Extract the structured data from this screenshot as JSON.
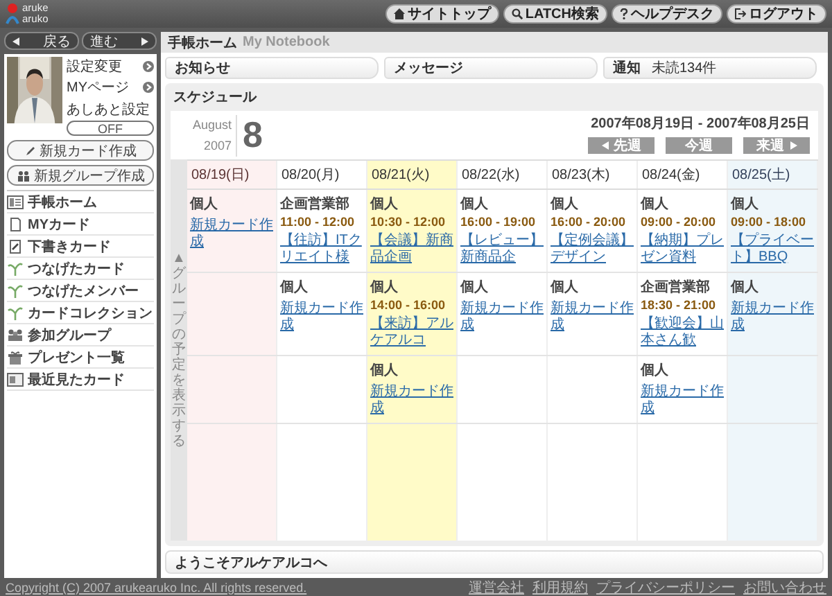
{
  "logo": {
    "line1": "aruke",
    "line2": "aruko"
  },
  "top_links": [
    {
      "kind": "home",
      "label": "サイトトップ"
    },
    {
      "kind": "search",
      "label": "LATCH検索"
    },
    {
      "kind": "help",
      "label": "ヘルプデスク"
    },
    {
      "kind": "logout",
      "label": "ログアウト"
    }
  ],
  "nav": {
    "back": "戻る",
    "forward": "進む"
  },
  "profile": {
    "links": [
      "設定変更",
      "MYページ"
    ],
    "footprint_label": "あしあと設定",
    "footprint_toggle": "OFF"
  },
  "actions": [
    {
      "kind": "pen",
      "label": "新規カード作成"
    },
    {
      "kind": "group",
      "label": "新規グループ作成"
    }
  ],
  "menu": [
    {
      "kind": "home",
      "label": "手帳ホーム"
    },
    {
      "kind": "card",
      "label": "MYカード"
    },
    {
      "kind": "draft",
      "label": "下書きカード"
    },
    {
      "kind": "link",
      "label": "つなげたカード"
    },
    {
      "kind": "link",
      "label": "つなげたメンバー"
    },
    {
      "kind": "link",
      "label": "カードコレクション"
    },
    {
      "kind": "group",
      "label": "参加グループ"
    },
    {
      "kind": "gift",
      "label": "プレゼント一覧"
    },
    {
      "kind": "recent",
      "label": "最近見たカード"
    }
  ],
  "page": {
    "title": "手帳ホーム",
    "subtitle": "My Notebook"
  },
  "tabs": [
    {
      "label": "お知らせ"
    },
    {
      "label": "メッセージ"
    },
    {
      "label": "通知",
      "count": "未読134件"
    }
  ],
  "schedule": {
    "title": "スケジュール",
    "month": "August",
    "year": "2007",
    "day": "8",
    "range": "2007年08月19日 - 2007年08月25日",
    "buttons": [
      {
        "kind": "prev",
        "label": "先週"
      },
      {
        "kind": "current",
        "label": "今週"
      },
      {
        "kind": "next",
        "label": "来週"
      }
    ],
    "side_toggle": "▲グループの予定を表示する",
    "days": [
      {
        "label": "08/19(日)",
        "kind": "sunday",
        "today": false,
        "entries": [
          {
            "group": "個人",
            "link": "新規カード作成"
          }
        ]
      },
      {
        "label": "08/20(月)",
        "kind": "weekday",
        "today": false,
        "entries": [
          {
            "group": "企画営業部",
            "time": "11:00 - 12:00",
            "link": "【往訪】ITクリエイト様"
          },
          {
            "group": "個人",
            "link": "新規カード作成"
          }
        ]
      },
      {
        "label": "08/21(火)",
        "kind": "weekday",
        "today": true,
        "entries": [
          {
            "group": "個人",
            "time": "10:30 - 12:00",
            "link": "【会議】新商品企画"
          },
          {
            "group": "個人",
            "time": "14:00 - 16:00",
            "link": "【来訪】アルケアルコ"
          },
          {
            "group": "個人",
            "link": "新規カード作成"
          }
        ]
      },
      {
        "label": "08/22(水)",
        "kind": "weekday",
        "today": false,
        "entries": [
          {
            "group": "個人",
            "time": "16:00 - 19:00",
            "link": "【レビュー】新商品企"
          },
          {
            "group": "個人",
            "link": "新規カード作成"
          }
        ]
      },
      {
        "label": "08/23(木)",
        "kind": "weekday",
        "today": false,
        "entries": [
          {
            "group": "個人",
            "time": "16:00 - 20:00",
            "link": "【定例会議】デザイン"
          },
          {
            "group": "個人",
            "link": "新規カード作成"
          }
        ]
      },
      {
        "label": "08/24(金)",
        "kind": "weekday",
        "today": false,
        "entries": [
          {
            "group": "個人",
            "time": "09:00 - 20:00",
            "link": "【納期】プレゼン資料"
          },
          {
            "group": "企画営業部",
            "time": "18:30 - 21:00",
            "link": "【歓迎会】山本さん歓"
          },
          {
            "group": "個人",
            "link": "新規カード作成"
          }
        ]
      },
      {
        "label": "08/25(土)",
        "kind": "saturday",
        "today": false,
        "entries": [
          {
            "group": "個人",
            "time": "09:00 - 18:00",
            "link": "【プライベート】BBQ"
          },
          {
            "group": "個人",
            "link": "新規カード作成"
          }
        ]
      }
    ]
  },
  "welcome": "ようこそアルケアルコへ",
  "footer": {
    "copyright": "Copyright (C) 2007 arukearuko Inc. All rights reserved.",
    "links": [
      "運営会社",
      "利用規約",
      "プライバシーポリシー",
      "お問い合わせ"
    ]
  }
}
